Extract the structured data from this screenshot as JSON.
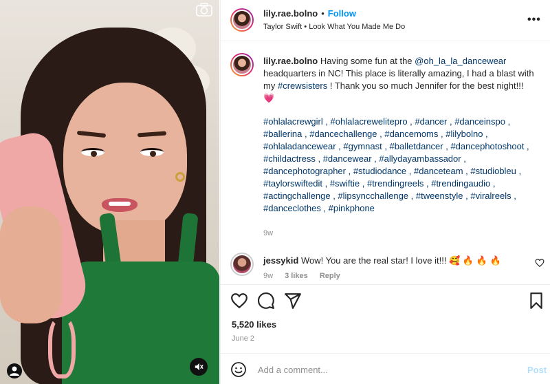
{
  "post": {
    "author": "lily.rae.bolno",
    "follow_label": "Follow",
    "separator": "•",
    "audio": "Taylor Swift • Look What You Made Me Do",
    "more_label": "•••"
  },
  "caption": {
    "username": "lily.rae.bolno",
    "text_1": "Having some fun at the",
    "mention": "@oh_la_la_dancewear",
    "text_2": "headquarters in NC! This place is literally amazing, I had a blast with my",
    "hashtag_inline": "#crewsisters",
    "text_3": "! Thank you so much Jennifer for the best night!!! 💗",
    "hashtags": "#ohlalacrewgirl , #ohlalacrewelitepro , #dancer , #danceinspo , #ballerina , #dancechallenge , #dancemoms , #lilybolno , #ohlaladancewear , #gymnast , #balletdancer , #dancephotoshoot , #childactress , #dancewear , #allydayambassador , #dancephotographer , #studiodance , #danceteam , #studiobleu , #taylorswiftedit , #swiftie , #trendingreels , #trendingaudio , #actingchallenge , #lipsyncchallenge , #tweenstyle , #viralreels , #danceclothes , #pinkphone",
    "time": "9w"
  },
  "comment": {
    "username": "jessykid",
    "text": "Wow! You are the real star! I love it!!! 🥰 🔥 🔥 🔥",
    "time": "9w",
    "likes": "3 likes",
    "reply": "Reply"
  },
  "stats": {
    "likes": "5,520 likes",
    "date": "June 2"
  },
  "composer": {
    "placeholder": "Add a comment...",
    "post_label": "Post"
  },
  "icons": [
    "camera-icon",
    "user-tag-icon",
    "mute-icon",
    "emoji-icon",
    "heart-icon",
    "comment-icon",
    "share-icon",
    "bookmark-icon"
  ],
  "colors": {
    "link": "#00376b",
    "follow": "#0095f6",
    "post_disabled": "#b2dffc",
    "dress": "#1f7a3a",
    "phone": "#f0a8a6"
  }
}
